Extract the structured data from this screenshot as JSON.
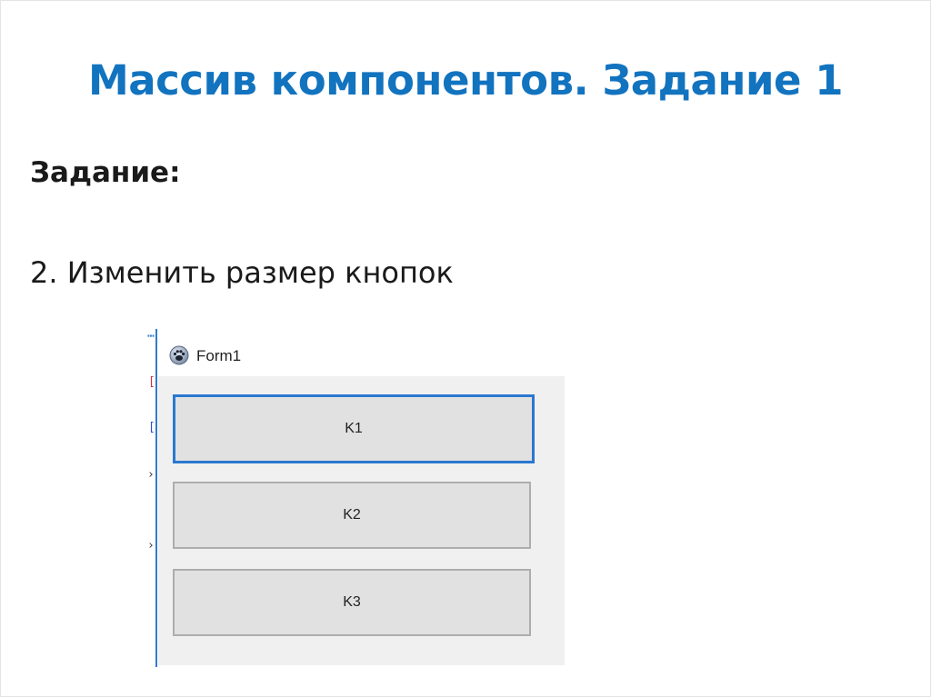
{
  "slide": {
    "title": "Массив компонентов. Задание 1",
    "task_heading": "Задание:",
    "task_item": "2. Изменить размер кнопок"
  },
  "form_window": {
    "title": "Form1",
    "icon": "paw-icon",
    "buttons": [
      {
        "label": "K1",
        "focused": true
      },
      {
        "label": "K2",
        "focused": false
      },
      {
        "label": "K3",
        "focused": false
      }
    ]
  },
  "colors": {
    "title": "#1273bf",
    "text": "#1a1a1a",
    "form_background": "#f0f0f0",
    "button_face": "#e1e1e1",
    "button_focus_border": "#2a78d0"
  }
}
